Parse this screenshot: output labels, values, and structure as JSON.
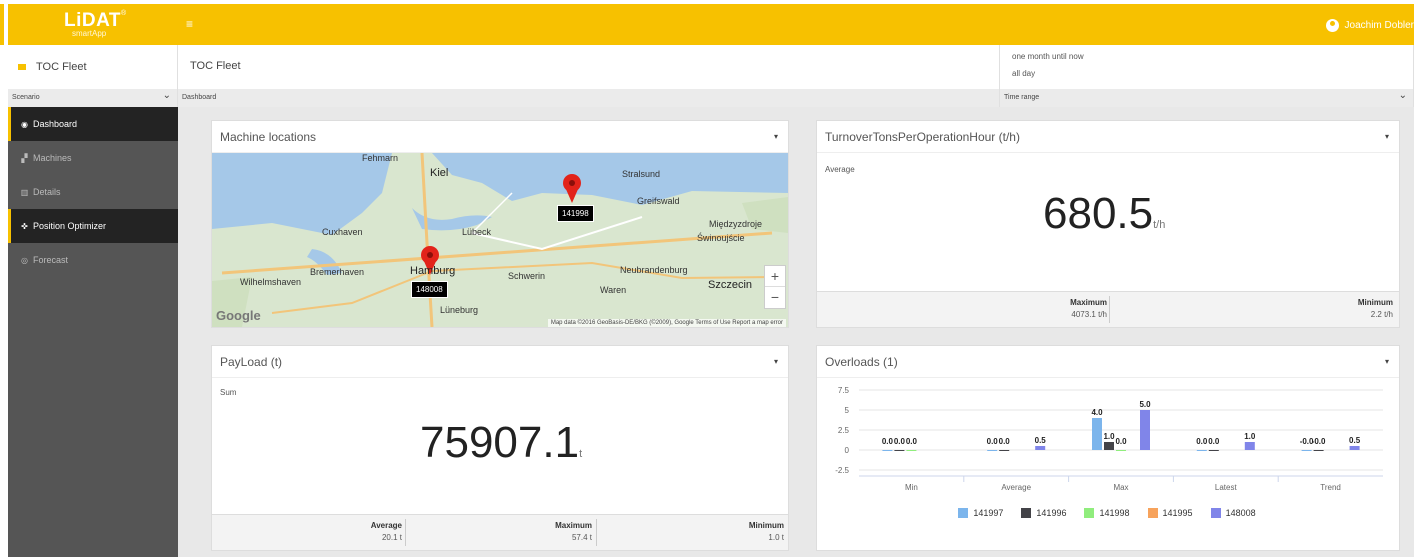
{
  "app": {
    "logo": "LiDAT",
    "logo_sub": "smartApp",
    "logo_mark": "®",
    "menu_icon": "≡",
    "user_name": "Joachim Dobler"
  },
  "filters": {
    "scenario": {
      "value": "TOC Fleet",
      "label": "Scenario"
    },
    "dashboard": {
      "value": "TOC Fleet",
      "label": "Dashboard"
    },
    "time_range": {
      "line1": "one month until now",
      "line2": "all day",
      "label": "Time range"
    }
  },
  "sidebar": {
    "items": [
      {
        "label": "Dashboard",
        "icon": "dashboard-icon",
        "glyph": "◉",
        "active": true
      },
      {
        "label": "Machines",
        "icon": "machines-icon",
        "glyph": "▞",
        "active": false
      },
      {
        "label": "Details",
        "icon": "chart-icon",
        "glyph": "▥",
        "active": false
      },
      {
        "label": "Position Optimizer",
        "icon": "crosshair-icon",
        "glyph": "✜",
        "active": true
      },
      {
        "label": "Forecast",
        "icon": "eye-icon",
        "glyph": "◎",
        "active": false
      }
    ]
  },
  "panels": {
    "map": {
      "title": "Machine locations",
      "pins": [
        {
          "label": "141998"
        },
        {
          "label": "148008"
        }
      ],
      "cities": [
        "Kiel",
        "Stralsund",
        "Greifswald",
        "Cuxhaven",
        "Lübeck",
        "Międzyzdroje",
        "Świnoujście",
        "Bremerhaven",
        "Hamburg",
        "Schwerin",
        "Neubrandenburg",
        "Wilhelmshaven",
        "Waren",
        "Szczecin",
        "Lüneburg",
        "Fehmarn"
      ],
      "attribution": "Map data ©2016 GeoBasis-DE/BKG (©2009), Google   Terms of Use   Report a map error",
      "zoom_in": "+",
      "zoom_out": "−",
      "google": "Google"
    },
    "turnover": {
      "title": "TurnoverTonsPerOperationHour (t/h)",
      "agg_label": "Average",
      "value": "680.5",
      "unit": "t/h",
      "max_label": "Maximum",
      "max_value": "4073.1 t/h",
      "min_label": "Minimum",
      "min_value": "2.2 t/h"
    },
    "payload": {
      "title": "PayLoad (t)",
      "agg_label": "Sum",
      "value": "75907.1",
      "unit": "t",
      "avg_label": "Average",
      "avg_value": "20.1 t",
      "max_label": "Maximum",
      "max_value": "57.4 t",
      "min_label": "Minimum",
      "min_value": "1.0 t"
    },
    "overloads": {
      "title": "Overloads (1)"
    }
  },
  "chart_data": {
    "type": "bar",
    "title": "Overloads (1)",
    "categories": [
      "Min",
      "Average",
      "Max",
      "Latest",
      "Trend"
    ],
    "yticks": [
      "7.5",
      "5",
      "2.5",
      "0",
      "-2.5"
    ],
    "ylim": [
      -2.5,
      7.5
    ],
    "legend_position": "bottom",
    "series": [
      {
        "name": "141997",
        "color": "#7cb5ec",
        "values": [
          0.0,
          0.0,
          4.0,
          0.0,
          -0.0
        ],
        "labels": [
          "0.0",
          "0.0",
          "4.0",
          "0.0",
          "-0.0"
        ]
      },
      {
        "name": "141996",
        "color": "#434348",
        "values": [
          0.0,
          0.0,
          1.0,
          0.0,
          -0.0
        ],
        "labels": [
          "0.0",
          "0.0",
          "1.0",
          "0.0",
          "-0.0"
        ]
      },
      {
        "name": "141998",
        "color": "#90ed7d",
        "values": [
          0.0,
          null,
          0.0,
          null,
          null
        ],
        "labels": [
          "0.0",
          "",
          "0.0",
          "",
          ""
        ]
      },
      {
        "name": "141995",
        "color": "#f7a35c",
        "values": [
          null,
          null,
          null,
          null,
          null
        ],
        "labels": [
          "",
          "",
          "",
          "",
          ""
        ]
      },
      {
        "name": "148008",
        "color": "#8085e9",
        "values": [
          null,
          0.5,
          5.0,
          1.0,
          0.5
        ],
        "labels": [
          "",
          "0.5",
          "5.0",
          "1.0",
          "0.5"
        ]
      }
    ]
  }
}
